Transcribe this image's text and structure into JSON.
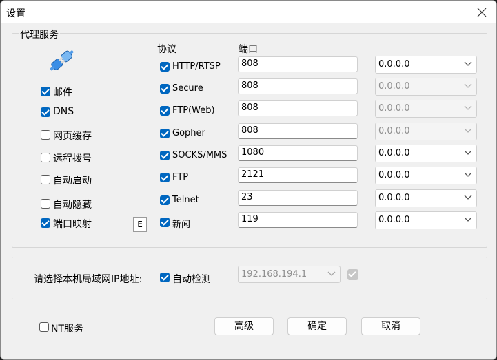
{
  "window": {
    "title": "设置"
  },
  "proxy_group": {
    "title": "代理服务",
    "left_options": [
      {
        "label": "邮件",
        "checked": true
      },
      {
        "label": "DNS",
        "checked": true
      },
      {
        "label": "网页缓存",
        "checked": false
      },
      {
        "label": "远程拨号",
        "checked": false
      },
      {
        "label": "自动启动",
        "checked": false
      },
      {
        "label": "自动隐藏",
        "checked": false
      },
      {
        "label": "端口映射",
        "checked": true
      }
    ],
    "e_button_label": "E",
    "header_protocol": "协议",
    "header_port": "端口",
    "protocols": [
      {
        "name": "HTTP/RTSP",
        "checked": true,
        "port": "808",
        "address": "0.0.0.0",
        "address_enabled": true
      },
      {
        "name": "Secure",
        "checked": true,
        "port": "808",
        "address": "0.0.0.0",
        "address_enabled": false
      },
      {
        "name": "FTP(Web)",
        "checked": true,
        "port": "808",
        "address": "0.0.0.0",
        "address_enabled": false
      },
      {
        "name": "Gopher",
        "checked": true,
        "port": "808",
        "address": "0.0.0.0",
        "address_enabled": false
      },
      {
        "name": "SOCKS/MMS",
        "checked": true,
        "port": "1080",
        "address": "0.0.0.0",
        "address_enabled": true
      },
      {
        "name": "FTP",
        "checked": true,
        "port": "2121",
        "address": "0.0.0.0",
        "address_enabled": true
      },
      {
        "name": "Telnet",
        "checked": true,
        "port": "23",
        "address": "0.0.0.0",
        "address_enabled": true
      },
      {
        "name": "新闻",
        "checked": true,
        "port": "119",
        "address": "0.0.0.0",
        "address_enabled": true
      }
    ]
  },
  "lan": {
    "prompt": "请选择本机局域网IP地址:",
    "auto_detect_label": "自动检测",
    "auto_detect_checked": true,
    "ip_value": "192.168.194.1"
  },
  "bottom": {
    "nt_service_label": "NT服务",
    "nt_service_checked": false,
    "advanced_label": "高级",
    "ok_label": "确定",
    "cancel_label": "取消"
  },
  "colors": {
    "accent": "#0067c0",
    "window_bg": "#f0f0f0"
  }
}
